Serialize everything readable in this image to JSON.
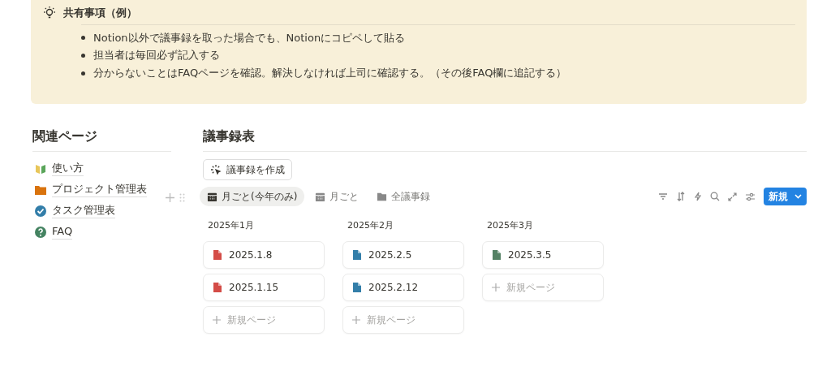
{
  "callout": {
    "title": "共有事項（例）",
    "items": [
      "Notion以外で議事録を取った場合でも、Notionにコピペして貼る",
      "担当者は毎回必ず記入する",
      "分からないことはFAQページを確認。解決しなければ上司に確認する。（その後FAQ欄に追記する）"
    ]
  },
  "related": {
    "title": "関連ページ",
    "links": [
      {
        "label": "使い方",
        "kind": "leaf"
      },
      {
        "label": "プロジェクト管理表",
        "kind": "folder"
      },
      {
        "label": "タスク管理表",
        "kind": "check"
      },
      {
        "label": "FAQ",
        "kind": "question"
      }
    ]
  },
  "database": {
    "title": "議事録表",
    "create_button": "議事録を作成",
    "views": [
      {
        "label": "月ごと(今年のみ)",
        "kind": "calendar",
        "selected": true
      },
      {
        "label": "月ごと",
        "kind": "calendar",
        "selected": false
      },
      {
        "label": "全議事録",
        "kind": "folder",
        "selected": false
      }
    ],
    "new_button": "新規",
    "groups": [
      {
        "label": "2025年1月",
        "cards": [
          {
            "title": "2025.1.8",
            "color": "#d44c47"
          },
          {
            "title": "2025.1.15",
            "color": "#d44c47"
          }
        ],
        "add": "新規ページ"
      },
      {
        "label": "2025年2月",
        "cards": [
          {
            "title": "2025.2.5",
            "color": "#337ea9"
          },
          {
            "title": "2025.2.12",
            "color": "#337ea9"
          }
        ],
        "add": "新規ページ"
      },
      {
        "label": "2025年3月",
        "cards": [
          {
            "title": "2025.3.5",
            "color": "#548164"
          }
        ],
        "add": "新規ページ"
      }
    ]
  }
}
